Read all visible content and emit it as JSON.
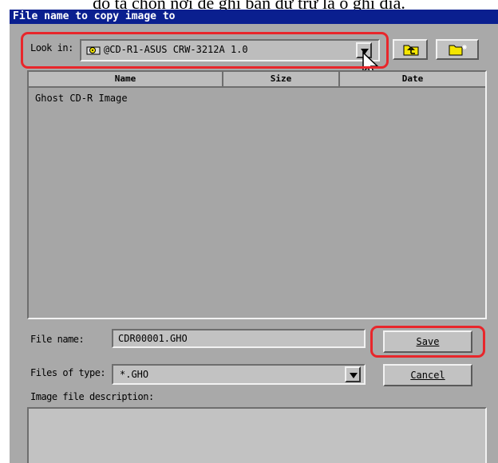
{
  "caption": "đó ta chọn nơi để ghi bản dự trữ là ổ ghi đĩa.",
  "dialog": {
    "title": "File name to copy image to",
    "look_in_label": "Look in:",
    "look_in_value": "@CD-R1-ASUS   CRW-3212A      1.0",
    "columns": [
      "Name",
      "Size",
      "Date"
    ],
    "items": [
      "Ghost CD-R Image"
    ],
    "file_name_label": "File name:",
    "file_name_value": "CDR00001.GHO",
    "files_of_type_label": "Files of type:",
    "files_of_type_value": "*.GHO",
    "image_desc_label": "Image file description:",
    "save_label": "Save",
    "cancel_label": "Cancel"
  },
  "colors": {
    "title_bar": "#0a1f8f",
    "dialog_bg": "#a9a9a9",
    "highlight": "#e8262b",
    "folder": "#f5e600"
  }
}
